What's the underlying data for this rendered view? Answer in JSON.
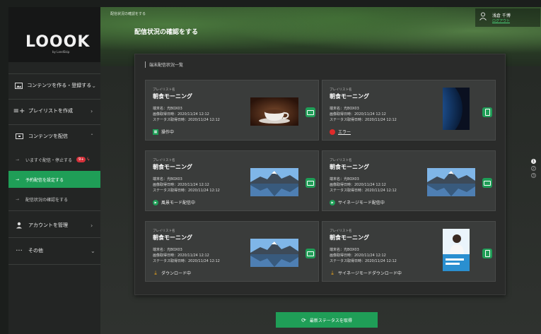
{
  "sidebar": {
    "logo": "LOOOK",
    "logo_sub": "by LandSkip",
    "items": [
      {
        "label": "コンテンツを作る・登録する",
        "icon": "image-icon"
      },
      {
        "label": "プレイリストを作成",
        "icon": "playlist-icon"
      },
      {
        "label": "コンテンツを配信",
        "icon": "display-icon"
      },
      {
        "label": "アカウントを管理",
        "icon": "user-icon"
      },
      {
        "label": "その他",
        "icon": "more-icon"
      }
    ],
    "sub_items": [
      {
        "label": "いますぐ配信・停止する",
        "badge": "9+"
      },
      {
        "label": "予約配信を設定する"
      },
      {
        "label": "配信状況の確認をする"
      }
    ]
  },
  "header": {
    "breadcrumb": "配信状況の確認をする",
    "title": "配信状況の確認をする",
    "user_name": "浅倉 千博",
    "logout": "ログアウト"
  },
  "panel": {
    "title": "端末配信状況一覧",
    "cards": [
      {
        "sm": "プレイリスト名",
        "playlist": "朝食モーニング",
        "terminal": "端末名：光BOX03",
        "image_time": "画像取得日時：2020/11/24 12:12",
        "status_time": "ステータス取得日時：2020/11/24 12:12",
        "status": "操作中",
        "status_icon": "operating-icon",
        "thumb": "coffee",
        "orientation": "landscape"
      },
      {
        "sm": "プレイリスト名",
        "playlist": "朝食モーニング",
        "terminal": "端末名：光BOX03",
        "image_time": "画像取得日時：2020/11/24 12:12",
        "status_time": "ステータス取得日時：2020/11/24 12:12",
        "status": "エラー",
        "status_icon": "error-icon",
        "thumb": "earth",
        "orientation": "portrait"
      },
      {
        "sm": "プレイリスト名",
        "playlist": "朝食モーニング",
        "terminal": "端末名：光BOX03",
        "image_time": "画像取得日時：2020/11/24 12:12",
        "status_time": "ステータス取得日時：2020/11/24 12:12",
        "status": "風景モード配信中",
        "status_icon": "play-icon",
        "thumb": "mountain",
        "orientation": "landscape"
      },
      {
        "sm": "プレイリスト名",
        "playlist": "朝食モーニング",
        "terminal": "端末名：光BOX03",
        "image_time": "画像取得日時：2020/11/24 12:12",
        "status_time": "ステータス取得日時：2020/11/24 12:12",
        "status": "サイネージモード配信中",
        "status_icon": "play-icon",
        "thumb": "mountain",
        "orientation": "landscape"
      },
      {
        "sm": "プレイリスト名",
        "playlist": "朝食モーニング",
        "terminal": "端末名：光BOX03",
        "image_time": "画像取得日時：2020/11/24 12:12",
        "status_time": "ステータス取得日時：2020/11/24 12:12",
        "status": "ダウンロード中",
        "status_icon": "download-icon",
        "thumb": "mountain",
        "orientation": "landscape"
      },
      {
        "sm": "プレイリスト名",
        "playlist": "朝食モーニング",
        "terminal": "端末名：光BOX03",
        "image_time": "画像取得日時：2020/11/24 12:12",
        "status_time": "ステータス取得日時：2020/11/24 12:12",
        "status": "サイネージモードダウンロード中",
        "status_icon": "download-icon",
        "thumb": "poster",
        "orientation": "portrait"
      }
    ]
  },
  "pagination": [
    "1",
    "2",
    "3"
  ],
  "refresh_label": "最新ステータスを取得",
  "colors": {
    "accent": "#1f9e57",
    "error": "#e02a2a",
    "download": "#f0a81e"
  }
}
